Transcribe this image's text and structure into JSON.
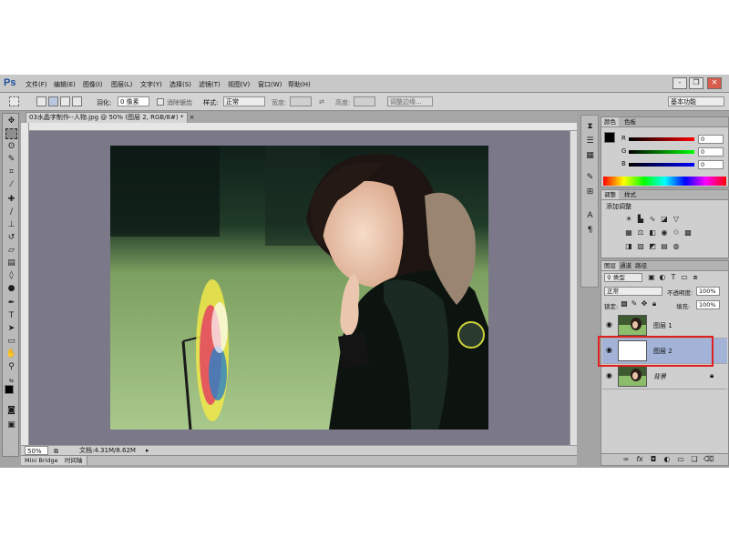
{
  "app": {
    "logo": "Ps"
  },
  "menubar": {
    "items": [
      "文件(F)",
      "编辑(E)",
      "图像(I)",
      "图层(L)",
      "文字(Y)",
      "选择(S)",
      "滤镜(T)",
      "视图(V)",
      "窗口(W)",
      "帮助(H)"
    ],
    "window_buttons": [
      "-",
      "❐",
      "✕"
    ]
  },
  "options": {
    "feather_label": "羽化:",
    "feather_value": "0 像素",
    "antialias_label": "消除锯齿",
    "style_label": "样式:",
    "style_value": "正常",
    "width_label": "宽度:",
    "height_label": "高度:",
    "refine_button": "调整边缘...",
    "workspace": "基本功能"
  },
  "document": {
    "tab_title": "03水晶字制作--人物.jpg @ 50% (图层 2, RGB/8#) *",
    "zoom": "50%",
    "doc_info": "文档:4.31M/8.62M"
  },
  "bottom_tabs": [
    "Mini Bridge",
    "时间轴"
  ],
  "color_panel": {
    "tabs": [
      "颜色",
      "色板"
    ],
    "channels": [
      {
        "label": "R",
        "value": "0",
        "color": "#cc0000"
      },
      {
        "label": "G",
        "value": "0",
        "color": "#00aa00"
      },
      {
        "label": "B",
        "value": "0",
        "color": "#0000cc"
      }
    ]
  },
  "adjust_panel": {
    "tabs": [
      "调整",
      "样式"
    ],
    "title": "添加调整",
    "icons": [
      "brightness-icon",
      "levels-icon",
      "curves-icon",
      "exposure-icon",
      "vibrance-icon",
      "hue-icon",
      "color-balance-icon",
      "bw-icon",
      "photo-filter-icon",
      "channel-mixer-icon",
      "color-lookup-icon",
      "invert-icon",
      "posterize-icon",
      "threshold-icon",
      "gradient-map-icon",
      "selective-color-icon"
    ]
  },
  "layers_panel": {
    "tabs": [
      "图层",
      "通道",
      "路径"
    ],
    "filter_kind": "类型",
    "blend_mode": "正常",
    "opacity_label": "不透明度:",
    "opacity_value": "100%",
    "lock_label": "锁定:",
    "fill_label": "填充:",
    "fill_value": "100%",
    "layers": [
      {
        "name": "图层 1",
        "selected": false
      },
      {
        "name": "图层 2",
        "selected": true
      },
      {
        "name": "背景",
        "selected": false
      }
    ],
    "bottom_icons": [
      "link-icon",
      "fx-icon",
      "mask-icon",
      "adjustment-icon",
      "group-icon",
      "new-layer-icon",
      "trash-icon"
    ]
  },
  "colors": {
    "app_bg": "#a4a4a4",
    "canvas_bg": "#7a7889",
    "selected_layer": "#a3b3d8",
    "highlight_box": "#e02020"
  }
}
